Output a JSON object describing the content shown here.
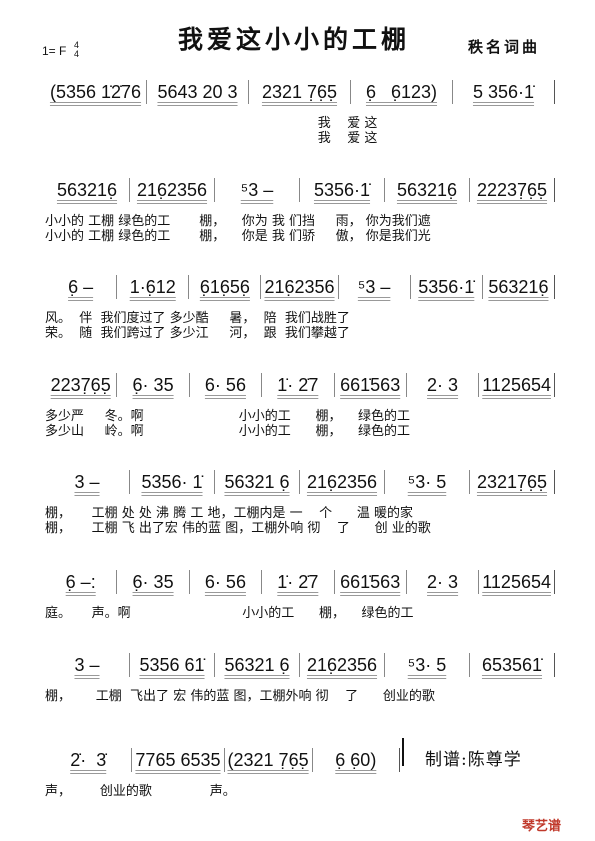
{
  "header": {
    "title": "我爱这小小的工棚",
    "composer": "秩名词曲",
    "key": "1= F",
    "time_sig": [
      "4",
      "4"
    ]
  },
  "rows": [
    {
      "notes": [
        "(5356 1̇2̇76",
        "5643 20 3",
        "2321 7̣6̣5̣",
        "6̣   6̣123)",
        "5 356·1̇"
      ],
      "lyrics": [
        "                                                                  我    爱 这",
        "                                                                  我    爱 这"
      ]
    },
    {
      "notes": [
        "563216̣",
        "216̣2356",
        "⁵3 –",
        "5356·1̇",
        "563216̣",
        "22237̣6̣5̣"
      ],
      "lyrics": [
        "小小的 工棚 绿色的工       棚，    你为 我 们挡     雨， 你为我们遮",
        "小小的 工棚 绿色的工       棚，    你是 我 们骄     傲， 你是我们光"
      ]
    },
    {
      "notes": [
        "6̣ –",
        "1·6̣12",
        "6̣16̣56̣",
        "216̣2356",
        "⁵3 –",
        "5356·1̇",
        "563216̣"
      ],
      "lyrics": [
        "风。  伴  我们度过了 多少酷     暑，  陪  我们战胜了",
        "荣。  随  我们跨过了 多少江     河，  跟  我们攀越了"
      ]
    },
    {
      "notes": [
        "2237̣6̣5̣",
        "6̣· 35",
        "6· 56",
        "1̇· 2̇7",
        "661̇563",
        "2· 3",
        "1125654"
      ],
      "lyrics": [
        "多少严     冬。啊                       小小的工      棚，    绿色的工",
        "多少山     岭。啊                       小小的工      棚，    绿色的工"
      ]
    },
    {
      "notes": [
        "3 –",
        "5356· 1̇",
        "56321 6̣",
        "216̣2356",
        "⁵3· 5",
        "23217̣6̣5̣"
      ],
      "lyrics": [
        "棚，     工棚 处 处 沸 腾 工 地，工棚内是 一    个      温 暖的家",
        "棚，     工棚 飞 出了宏 伟的蓝 图，工棚外响 彻    了      创 业的歌"
      ]
    },
    {
      "notes": [
        "6̣ –:",
        "6̣· 35",
        "6· 56",
        "1̇· 2̇7",
        "661̇563",
        "2· 3",
        "1125654"
      ],
      "lyrics": [
        "庭。     声。啊                           小小的工      棚，    绿色的工"
      ]
    },
    {
      "notes": [
        "3 –",
        "5356 61̇",
        "56321 6̣",
        "216̣2356",
        "⁵3· 5",
        "653561̇"
      ],
      "lyrics": [
        "棚，      工棚  飞出了 宏 伟的蓝 图，工棚外响 彻    了      创业的歌"
      ]
    },
    {
      "notes": [
        "2̇·  3̇",
        "7765 6535",
        "(2321 7̣6̣5̣",
        "6̣ 6̣0)"
      ],
      "lyrics": [
        "声，       创业的歌              声。"
      ]
    }
  ],
  "footer": {
    "credit": "制谱:陈尊学",
    "watermark": "琴艺谱",
    "watermark_color": "#c0392b"
  }
}
